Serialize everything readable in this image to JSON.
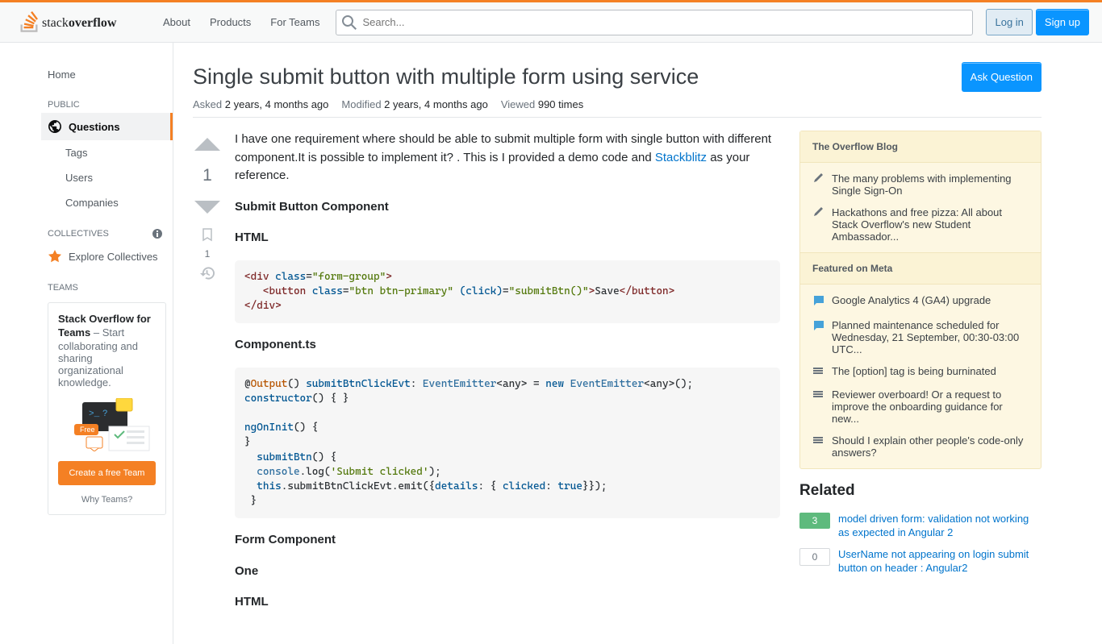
{
  "header": {
    "nav": [
      "About",
      "Products",
      "For Teams"
    ],
    "search_placeholder": "Search...",
    "login": "Log in",
    "signup": "Sign up"
  },
  "sidebar": {
    "home": "Home",
    "public_label": "PUBLIC",
    "questions": "Questions",
    "tags": "Tags",
    "users": "Users",
    "companies": "Companies",
    "collectives_label": "COLLECTIVES",
    "explore_collectives": "Explore Collectives",
    "teams_label": "TEAMS",
    "teams_title": "Stack Overflow for Teams",
    "teams_desc": " – Start collaborating and sharing organizational knowledge.",
    "create_team": "Create a free Team",
    "why_teams": "Why Teams?"
  },
  "question": {
    "title": "Single submit button with multiple form using service",
    "ask_button": "Ask Question",
    "asked_label": "Asked",
    "asked_value": "2 years, 4 months ago",
    "modified_label": "Modified",
    "modified_value": "2 years, 4 months ago",
    "viewed_label": "Viewed",
    "viewed_value": "990 times",
    "vote_count": "1",
    "bookmark_count": "1",
    "body_intro_1": "I have one requirement where should be able to submit multiple form with single button with different component.It is possible to implement it? . This is I provided a demo code and ",
    "stackblitz_link": "Stackblitz",
    "body_intro_2": " as your reference.",
    "heading_submit": "Submit Button Component",
    "heading_html": "HTML",
    "heading_component_ts": "Component.ts",
    "heading_form": "Form Component",
    "heading_one": "One",
    "heading_html2": "HTML"
  },
  "blog": {
    "header1": "The Overflow Blog",
    "item1": "The many problems with implementing Single Sign-On",
    "item2": "Hackathons and free pizza: All about Stack Overflow's new Student Ambassador...",
    "header2": "Featured on Meta",
    "item3": "Google Analytics 4 (GA4) upgrade",
    "item4": "Planned maintenance scheduled for Wednesday, 21 September, 00:30-03:00 UTC...",
    "item5": "The [option] tag is being burninated",
    "item6": "Reviewer overboard! Or a request to improve the onboarding guidance for new...",
    "item7": "Should I explain other people's code-only answers?"
  },
  "related": {
    "title": "Related",
    "items": [
      {
        "score": "3",
        "style": "green",
        "text": "model driven form: validation not working as expected in Angular 2"
      },
      {
        "score": "0",
        "style": "grey",
        "text": "UserName not appearing on login submit button on header : Angular2"
      }
    ]
  }
}
